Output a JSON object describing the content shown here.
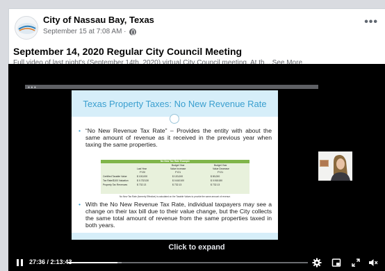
{
  "post": {
    "page_name": "City of Nassau Bay, Texas",
    "meta_text": "September 15 at 7:08 AM ·",
    "more_label": "•••",
    "title": "September 14, 2020 Regular City Council Meeting",
    "description": "Full video of last night's (September 14th, 2020) virtual City Council meeting. At th...",
    "see_more": "See More"
  },
  "slide": {
    "title": "Texas Property Taxes: No New Revenue Rate",
    "bullet_1": "“No New Revenue Tax Rate” – Provides the entity with about the same amount of revenue as it received in the previous year when taxing the same properties.",
    "bullet_2": "With the No New Revenue Tax Rate, individual taxpayers may see a change on their tax bill due to their value change, but the City collects the same total amount of revenue from the same properties taxed in both years.",
    "table": {
      "header": "No New Tax Rate Example",
      "col_b_top": "Budget Year",
      "col_b_mid": "Value Increase",
      "col_b_bot": "FY21",
      "col_a_mid": "Last Year",
      "col_a_bot": "FY20",
      "col_c_top": "Budget Year",
      "col_c_mid": "Value Decrease",
      "col_c_bot": "FY21",
      "rows": [
        {
          "label": "Certified Taxable Value",
          "a": "$      100,000",
          "b": "$      120,000",
          "c": "$       80,000"
        },
        {
          "label": "Tax Rate/$100 Valuation",
          "a": "$    0.732130",
          "b": "$    0.610100",
          "c": "$    0.915150"
        },
        {
          "label": "Property Tax Revenues",
          "a": "$        732.13",
          "b": "$        732.13",
          "c": "$        732.13"
        }
      ],
      "note": "No New Tax Rate (formerly Effective) is calculated on the Taxable Values to provide the same amount of revenue."
    }
  },
  "video": {
    "click_expand": "Click to expand",
    "time": "27:36 / 2:13:43",
    "progress_played": 0.206,
    "progress_buffered": 0.224
  },
  "colors": {
    "slide_accent": "#3a9fcf",
    "table_header": "#80b54a"
  },
  "icons": [
    "globe-icon",
    "pause-icon",
    "settings-gear-icon",
    "mini-player-icon",
    "fullscreen-icon",
    "volume-icon"
  ]
}
